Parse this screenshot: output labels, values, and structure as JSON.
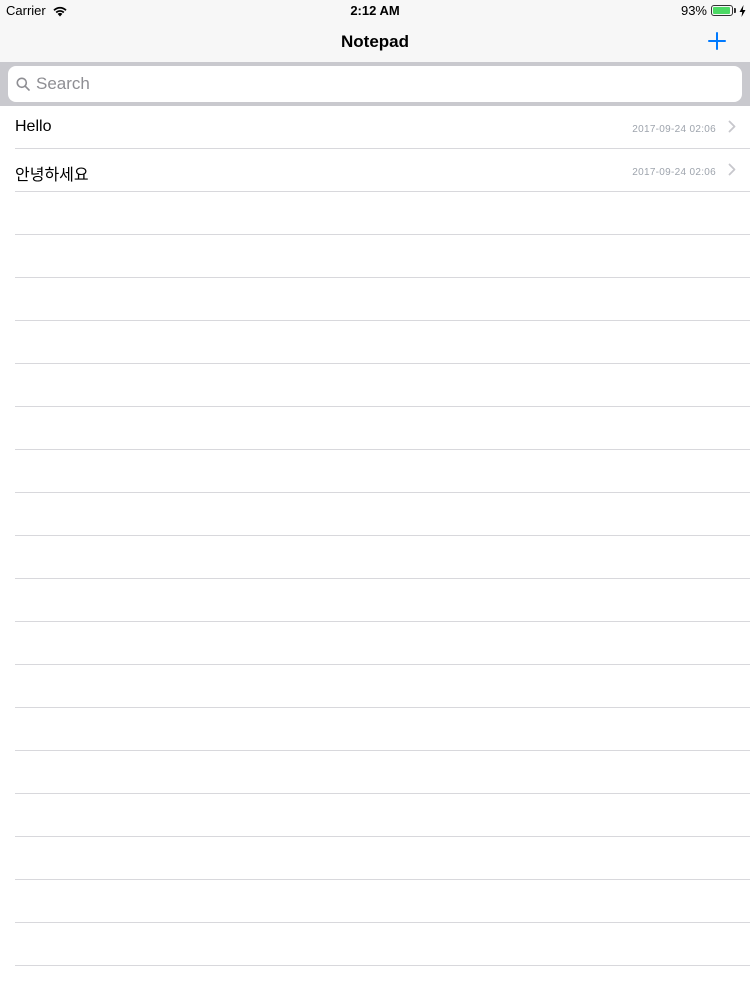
{
  "status_bar": {
    "carrier": "Carrier",
    "time": "2:12 AM",
    "battery_percent": "93%",
    "battery_level": 0.93,
    "battery_color": "#4cd964"
  },
  "nav": {
    "title": "Notepad",
    "add_icon": "plus-icon",
    "accent_color": "#007aff"
  },
  "search": {
    "placeholder": "Search",
    "value": ""
  },
  "notes": [
    {
      "title": "Hello",
      "date": "2017-09-24 02:06"
    },
    {
      "title": "안녕하세요",
      "date": "2017-09-24 02:06"
    }
  ]
}
